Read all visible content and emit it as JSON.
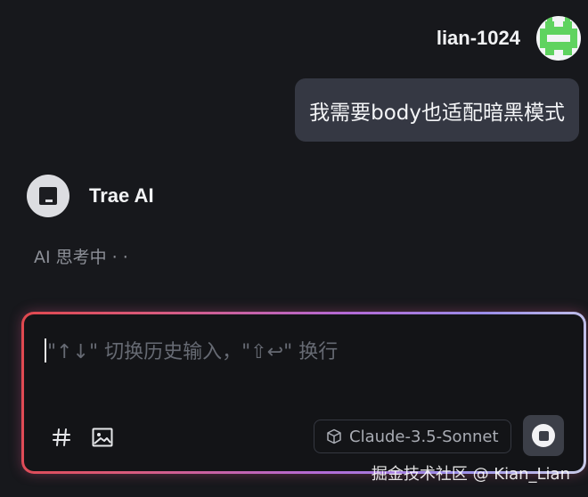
{
  "user": {
    "name": "lian-1024",
    "avatar_color": "#5fd35f",
    "message": "我需要body也适配暗黑模式"
  },
  "assistant": {
    "name": "Trae AI",
    "status": "AI 思考中 · ·"
  },
  "composer": {
    "placeholder": "\"↑↓\" 切换历史输入，\"⇧↩\" 换行",
    "hash_icon": "#",
    "image_icon": "image-icon",
    "model_icon": "cube-icon",
    "model_label": "Claude-3.5-Sonnet",
    "stop_icon": "stop-icon",
    "border_gradient": [
      "#e0484e",
      "#b36ad6",
      "#c9cbe8"
    ]
  },
  "watermark": "掘金技术社区 @ Kian_Lian"
}
